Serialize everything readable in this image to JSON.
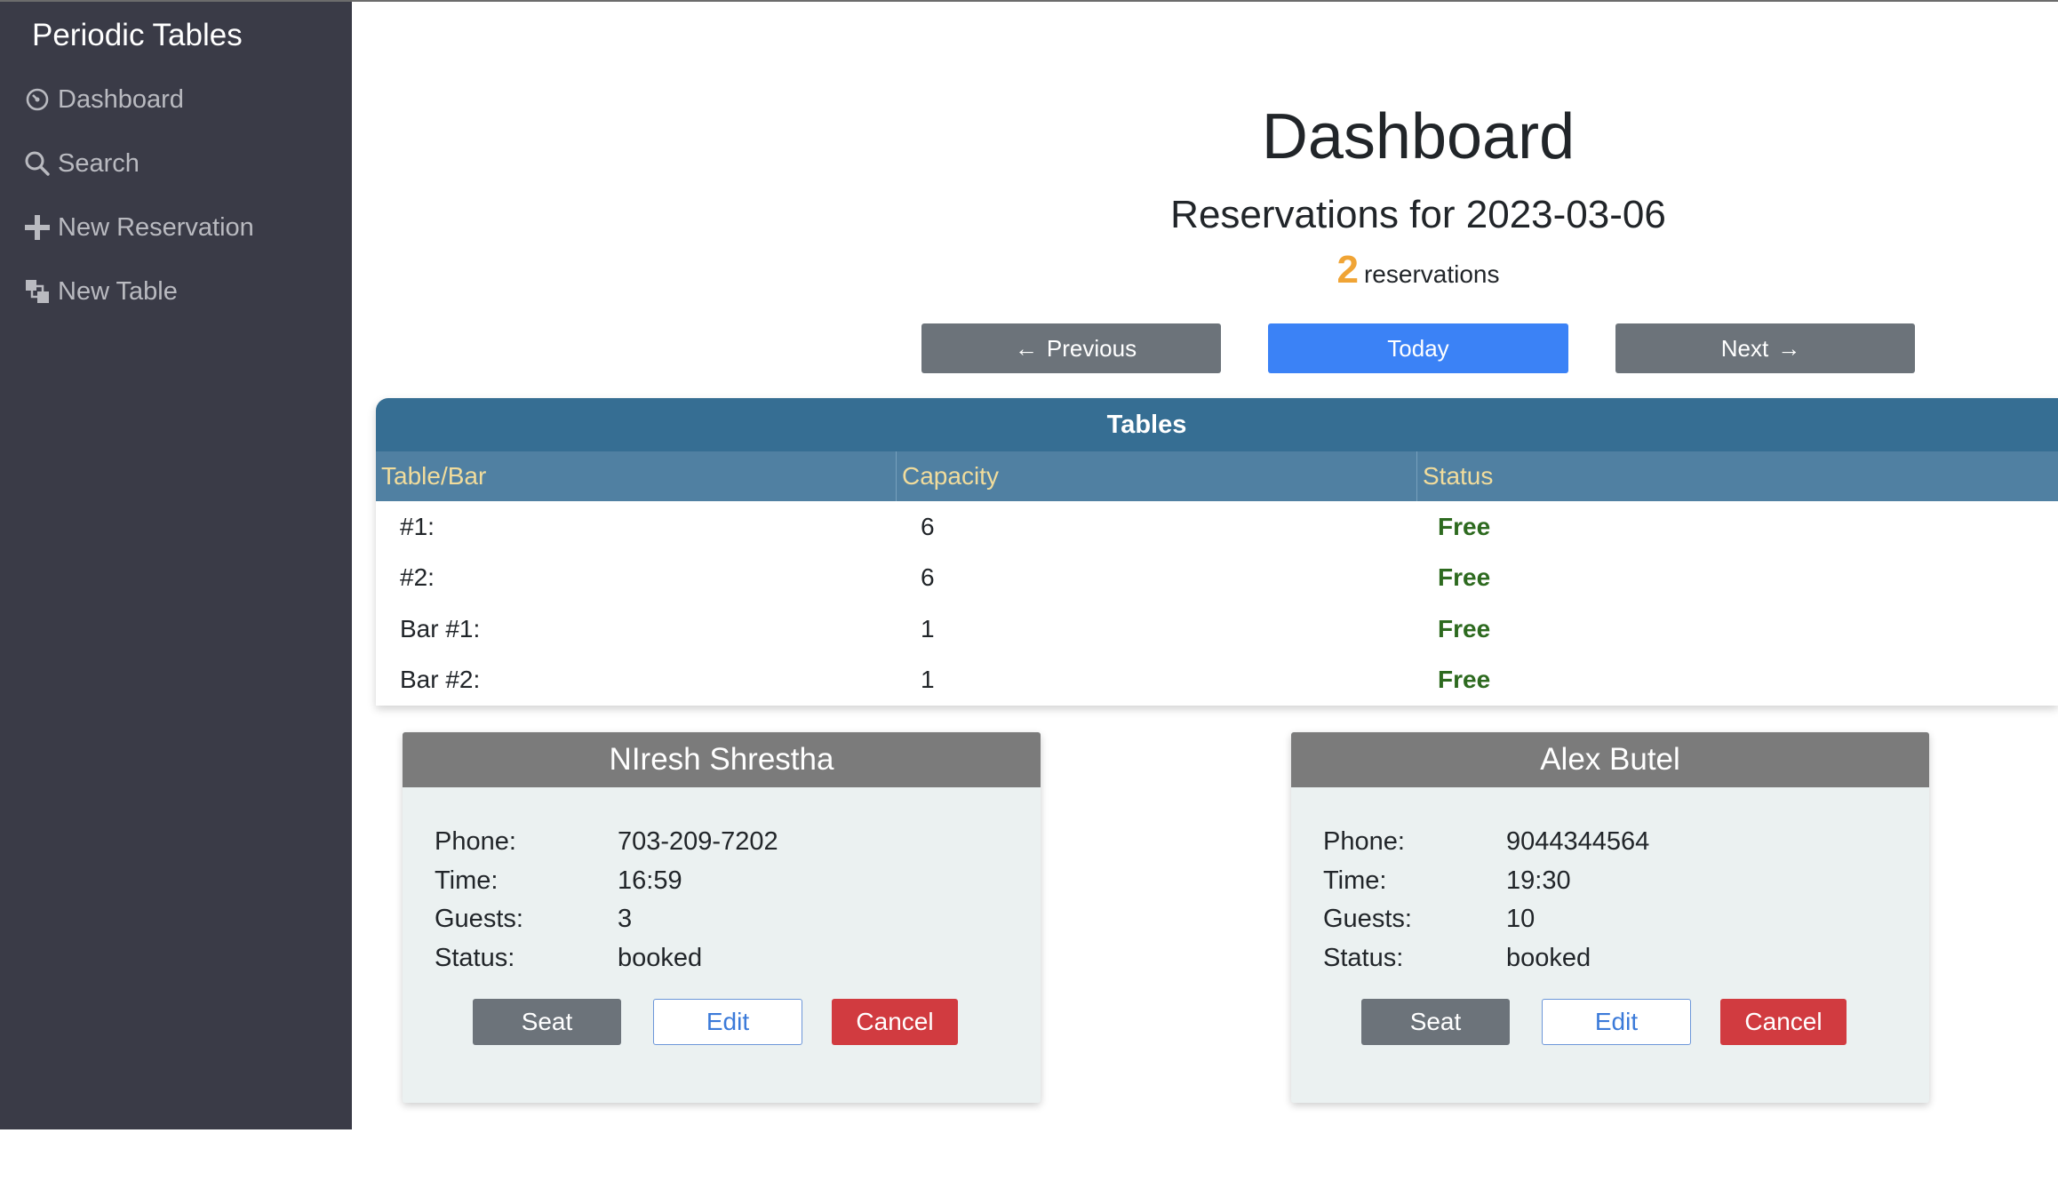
{
  "app": {
    "brand": "Periodic Tables"
  },
  "sidebar": {
    "items": [
      {
        "label": "Dashboard",
        "icon": "dashboard-icon"
      },
      {
        "label": "Search",
        "icon": "search-icon"
      },
      {
        "label": "New Reservation",
        "icon": "plus-icon"
      },
      {
        "label": "New Table",
        "icon": "layers-icon"
      }
    ]
  },
  "header": {
    "title": "Dashboard",
    "subtitle": "Reservations for 2023-03-06",
    "count": "2",
    "count_label": "reservations"
  },
  "nav_buttons": {
    "previous": "Previous",
    "today": "Today",
    "next": "Next"
  },
  "tables": {
    "title": "Tables",
    "columns": [
      "Table/Bar",
      "Capacity",
      "Status"
    ],
    "rows": [
      {
        "name": "#1:",
        "capacity": "6",
        "status": "Free"
      },
      {
        "name": "#2:",
        "capacity": "6",
        "status": "Free"
      },
      {
        "name": "Bar #1:",
        "capacity": "1",
        "status": "Free"
      },
      {
        "name": "Bar #2:",
        "capacity": "1",
        "status": "Free"
      }
    ]
  },
  "field_labels": {
    "phone": "Phone:",
    "time": "Time:",
    "guests": "Guests:",
    "status": "Status:"
  },
  "reservations": [
    {
      "name": "NIresh Shrestha",
      "phone": "703-209-7202",
      "time": "16:59",
      "guests": "3",
      "status": "booked"
    },
    {
      "name": "Alex Butel",
      "phone": "9044344564",
      "time": "19:30",
      "guests": "10",
      "status": "booked"
    }
  ],
  "card_actions": {
    "seat": "Seat",
    "edit": "Edit",
    "cancel": "Cancel"
  },
  "colors": {
    "sidebar_bg": "#3a3b47",
    "accent_blue": "#3b82f6",
    "count_orange": "#f0a435",
    "free_green": "#2d6a1f",
    "cancel_red": "#d13b40",
    "table_header": "#366e93"
  }
}
